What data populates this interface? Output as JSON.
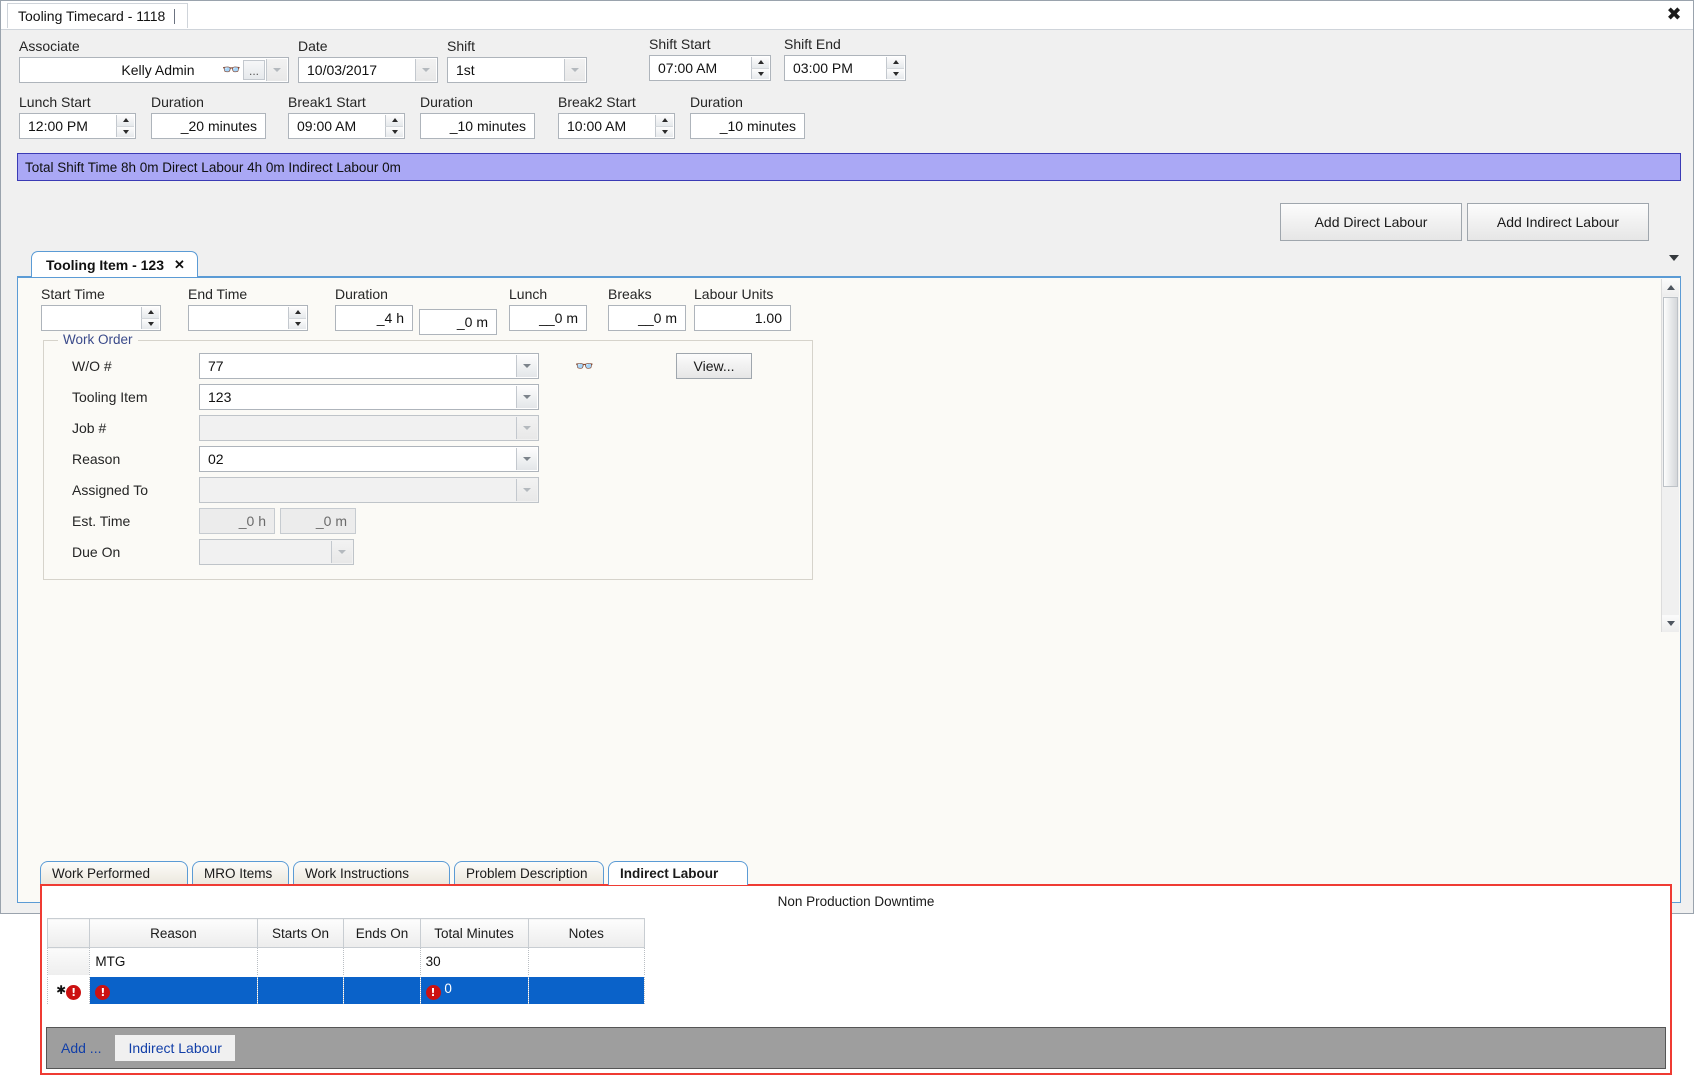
{
  "window": {
    "doc_tab": "Tooling Timecard - 1118",
    "close_icon": "close-icon"
  },
  "header_form": {
    "associate": {
      "label": "Associate",
      "value": "Kelly Admin",
      "ellipsis": "...",
      "search_icon": "binoculars-icon"
    },
    "date": {
      "label": "Date",
      "value": "10/03/2017"
    },
    "shift": {
      "label": "Shift",
      "value": "1st"
    },
    "shift_start": {
      "label": "Shift Start",
      "value": "07:00 AM"
    },
    "shift_end": {
      "label": "Shift End",
      "value": "03:00 PM"
    },
    "lunch_start": {
      "label": "Lunch Start",
      "value": "12:00 PM"
    },
    "lunch_duration": {
      "label": "Duration",
      "value": "_20 minutes"
    },
    "break1_start": {
      "label": "Break1 Start",
      "value": "09:00 AM"
    },
    "break1_duration": {
      "label": "Duration",
      "value": "_10 minutes"
    },
    "break2_start": {
      "label": "Break2 Start",
      "value": "10:00 AM"
    },
    "break2_duration": {
      "label": "Duration",
      "value": "_10 minutes"
    }
  },
  "summary_bar": {
    "text": "Total Shift Time 8h 0m  Direct Labour 4h 0m  Indirect Labour 0m",
    "background": "#aaa8f5",
    "border": "#3b3bb5"
  },
  "actions": {
    "add_direct_labour": "Add Direct Labour",
    "add_indirect_labour": "Add Indirect Labour"
  },
  "item_tab": {
    "label": "Tooling Item - 123",
    "close": "✕"
  },
  "time_row": {
    "start_time": {
      "label": "Start Time",
      "value": ""
    },
    "end_time": {
      "label": "End Time",
      "value": ""
    },
    "duration": {
      "label": "Duration",
      "hours": "_4 h",
      "minutes": "_0 m"
    },
    "lunch": {
      "label": "Lunch",
      "value": "__0 m"
    },
    "breaks": {
      "label": "Breaks",
      "value": "__0 m"
    },
    "labour_units": {
      "label": "Labour Units",
      "value": "1.00"
    }
  },
  "work_order": {
    "group_title": "Work Order",
    "rows": [
      {
        "label": "W/O #",
        "value": "77",
        "disabled": false
      },
      {
        "label": "Tooling Item",
        "value": "123",
        "disabled": false
      },
      {
        "label": "Job #",
        "value": "",
        "disabled": true
      },
      {
        "label": "Reason",
        "value": "02",
        "disabled": false
      },
      {
        "label": "Assigned To",
        "value": "",
        "disabled": true
      }
    ],
    "est_time": {
      "label": "Est. Time",
      "hours": "_0 h",
      "minutes": "_0 m"
    },
    "due_on": {
      "label": "Due On",
      "value": ""
    },
    "search_icon": "binoculars-icon",
    "view_button": "View..."
  },
  "bottom_tabs": [
    {
      "label": "Work Performed",
      "active": false
    },
    {
      "label": "MRO Items",
      "active": false
    },
    {
      "label": "Work Instructions",
      "active": false
    },
    {
      "label": "Problem Description",
      "active": false
    },
    {
      "label": "Indirect Labour",
      "active": true
    }
  ],
  "downtime_panel": {
    "title": "Non Production Downtime",
    "border_color": "#ef3b33",
    "columns": [
      "",
      "Reason",
      "Starts On",
      "Ends On",
      "Total Minutes",
      "Notes"
    ],
    "rows": [
      {
        "selected": false,
        "row_marker": "",
        "reason": "MTG",
        "starts_on": "",
        "ends_on": "",
        "total_minutes": "30",
        "notes": ""
      },
      {
        "selected": true,
        "row_marker": "new-row",
        "reason": "",
        "reason_error": "!",
        "starts_on": "",
        "ends_on": "",
        "total_minutes": "0",
        "total_minutes_error": "!",
        "notes": ""
      }
    ]
  },
  "footer": {
    "add_label": "Add ...",
    "indirect_labour_button": "Indirect Labour",
    "background": "#9e9e9e"
  }
}
